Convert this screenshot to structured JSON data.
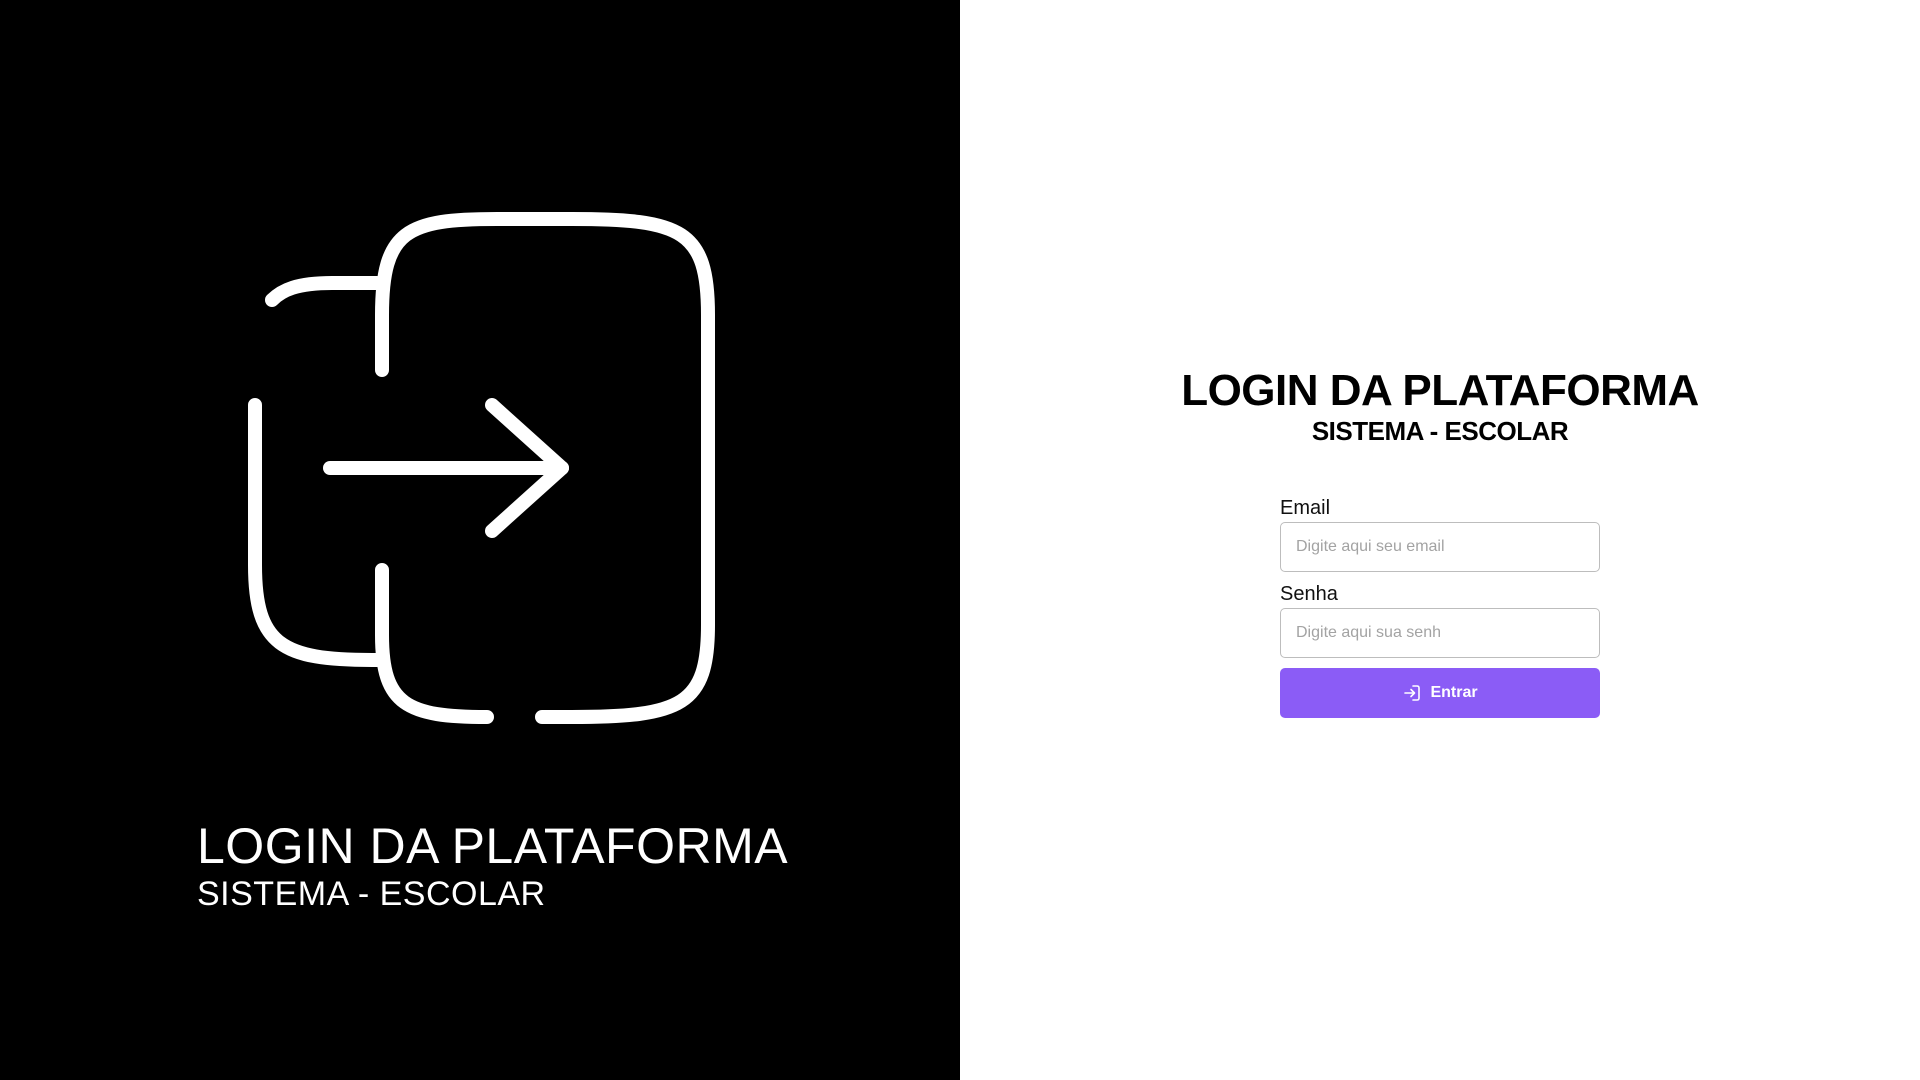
{
  "colors": {
    "left_background": "#000000",
    "right_background": "#ffffff",
    "accent": "#8b5cf6",
    "text_light": "#ffffff",
    "text_dark": "#000000",
    "input_border": "#bdbdbd",
    "placeholder": "#a3a3a3"
  },
  "left_panel": {
    "icon": "login-arrow-icon",
    "title": "LOGIN DA PLATAFORMA",
    "subtitle": "SISTEMA - ESCOLAR"
  },
  "right_panel": {
    "title": "LOGIN DA PLATAFORMA",
    "subtitle": "SISTEMA - ESCOLAR",
    "form": {
      "email": {
        "label": "Email",
        "value": "",
        "placeholder": "Digite aqui seu email"
      },
      "password": {
        "label": "Senha",
        "value": "",
        "placeholder": "Digite aqui sua senh"
      },
      "submit": {
        "icon": "login-icon",
        "label": "Entrar"
      }
    }
  }
}
